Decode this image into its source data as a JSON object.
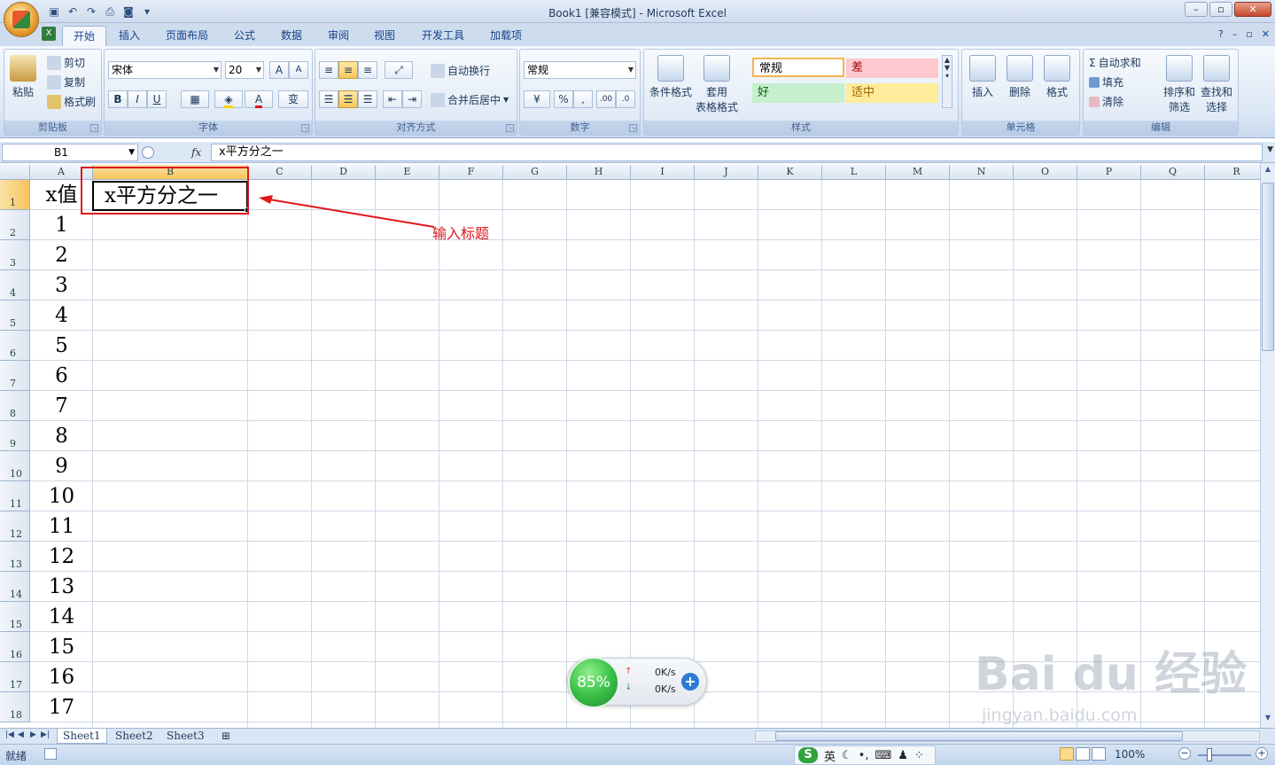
{
  "window": {
    "title": "Book1  [兼容模式] - Microsoft Excel"
  },
  "tabs": [
    "开始",
    "插入",
    "页面布局",
    "公式",
    "数据",
    "审阅",
    "视图",
    "开发工具",
    "加载项"
  ],
  "ribbon": {
    "clipboard": {
      "label": "剪贴板",
      "paste": "粘贴",
      "cut": "剪切",
      "copy": "复制",
      "format_painter": "格式刷"
    },
    "font": {
      "label": "字体",
      "name": "宋体",
      "size": "20"
    },
    "alignment": {
      "label": "对齐方式",
      "wrap": "自动换行",
      "merge": "合并后居中"
    },
    "number": {
      "label": "数字",
      "format": "常规"
    },
    "styles": {
      "label": "样式",
      "cond_format": "条件格式",
      "table_format_1": "套用",
      "table_format_2": "表格格式",
      "normal": "常规",
      "bad": "差",
      "good": "好",
      "neutral": "适中"
    },
    "cells": {
      "label": "单元格",
      "insert": "插入",
      "delete": "删除",
      "format": "格式"
    },
    "editing": {
      "label": "编辑",
      "autosum": "自动求和",
      "fill": "填充",
      "clear": "清除",
      "sort_1": "排序和",
      "sort_2": "筛选",
      "find_1": "查找和",
      "find_2": "选择"
    }
  },
  "formula_bar": {
    "name_box": "B1",
    "fx": "fx",
    "content": "x平方分之一"
  },
  "sheet": {
    "columns": [
      "A",
      "B",
      "C",
      "D",
      "E",
      "F",
      "G",
      "H",
      "I",
      "J",
      "K",
      "L",
      "M",
      "N",
      "O",
      "P",
      "Q",
      "R"
    ],
    "rows": [
      "1",
      "2",
      "3",
      "4",
      "5",
      "6",
      "7",
      "8",
      "9",
      "10",
      "11",
      "12",
      "13",
      "14",
      "15",
      "16",
      "17",
      "18"
    ],
    "A_values": [
      "x值",
      "1",
      "2",
      "3",
      "4",
      "5",
      "6",
      "7",
      "8",
      "9",
      "10",
      "11",
      "12",
      "13",
      "14",
      "15",
      "16",
      "17"
    ],
    "B1": "x平方分之一",
    "annotation": "输入标题",
    "tabs": [
      "Sheet1",
      "Sheet2",
      "Sheet3"
    ]
  },
  "status": {
    "ready": "就绪",
    "zoom": "100%",
    "ime_label": "英"
  },
  "speed_widget": {
    "percent": "85%",
    "up": "0K/s",
    "down": "0K/s"
  },
  "watermark": {
    "brand": "Bai du 经验",
    "url": "jingyan.baidu.com"
  },
  "colors": {
    "accent_red": "#e0161b",
    "selected_header": "#f6c45b"
  }
}
